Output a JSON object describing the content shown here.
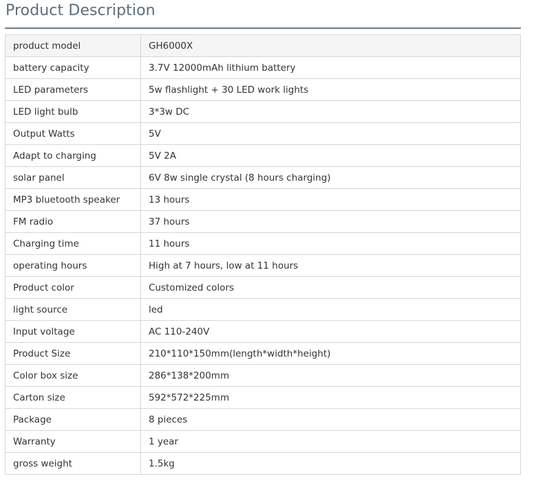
{
  "section": {
    "title": "Product Description"
  },
  "specs": [
    {
      "label": "product model",
      "value": "GH6000X"
    },
    {
      "label": "battery capacity",
      "value": "3.7V 12000mAh lithium battery"
    },
    {
      "label": "LED parameters",
      "value": "5w flashlight + 30 LED work lights"
    },
    {
      "label": "LED light bulb",
      "value": "3*3w DC"
    },
    {
      "label": "Output Watts",
      "value": "5V"
    },
    {
      "label": "Adapt to charging",
      "value": "5V 2A"
    },
    {
      "label": "solar panel",
      "value": "6V 8w single crystal (8 hours charging)"
    },
    {
      "label": "MP3 bluetooth speaker",
      "value": "13 hours"
    },
    {
      "label": "FM radio",
      "value": "37 hours"
    },
    {
      "label": "Charging time",
      "value": "11 hours"
    },
    {
      "label": "operating hours",
      "value": "High at 7 hours, low at 11 hours"
    },
    {
      "label": "Product color",
      "value": "Customized colors"
    },
    {
      "label": "light source",
      "value": "led"
    },
    {
      "label": "Input voltage",
      "value": "AC 110-240V"
    },
    {
      "label": "Product Size",
      "value": "210*110*150mm(length*width*height)"
    },
    {
      "label": "Color box size",
      "value": "286*138*200mm"
    },
    {
      "label": "Carton size",
      "value": "592*572*225mm"
    },
    {
      "label": "Package",
      "value": "8 pieces"
    },
    {
      "label": "Warranty",
      "value": "1 year"
    },
    {
      "label": "gross weight",
      "value": "1.5kg"
    }
  ]
}
